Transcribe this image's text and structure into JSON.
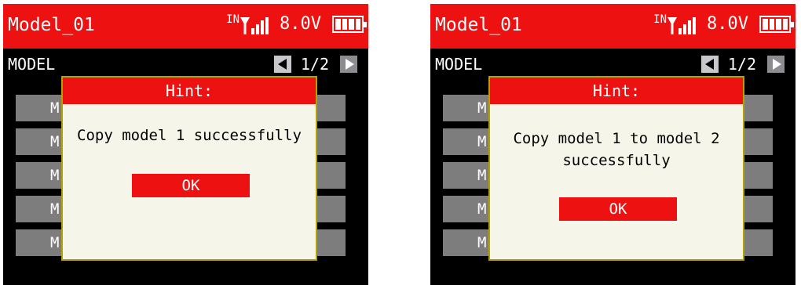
{
  "screens": [
    {
      "model_name": "Model_01",
      "signal_label": "IN",
      "voltage": "8.0V",
      "menu_title": "MODEL",
      "page": "1/2",
      "list_buttons": [
        "M",
        "M",
        "M",
        "M",
        "M"
      ],
      "dialog": {
        "title": "Hint:",
        "message": "Copy model 1 successfully",
        "ok_label": "OK"
      }
    },
    {
      "model_name": "Model_01",
      "signal_label": "IN",
      "voltage": "8.0V",
      "menu_title": "MODEL",
      "page": "1/2",
      "list_buttons": [
        "M",
        "M",
        "M",
        "M",
        "M"
      ],
      "dialog": {
        "title": "Hint:",
        "message": "Copy model 1 to model 2 successfully",
        "ok_label": "OK"
      }
    }
  ],
  "colors": {
    "title_bar": "#ee1111",
    "screen_bg": "#000000",
    "list_button": "#7d7d7d",
    "dialog_bg": "#f5f5ea",
    "dialog_border": "#b3a200",
    "ok_button": "#ee1111"
  },
  "icons": {
    "signal": "antenna-signal-icon",
    "battery": "battery-icon",
    "prev": "arrow-left-icon",
    "next": "arrow-right-icon"
  }
}
